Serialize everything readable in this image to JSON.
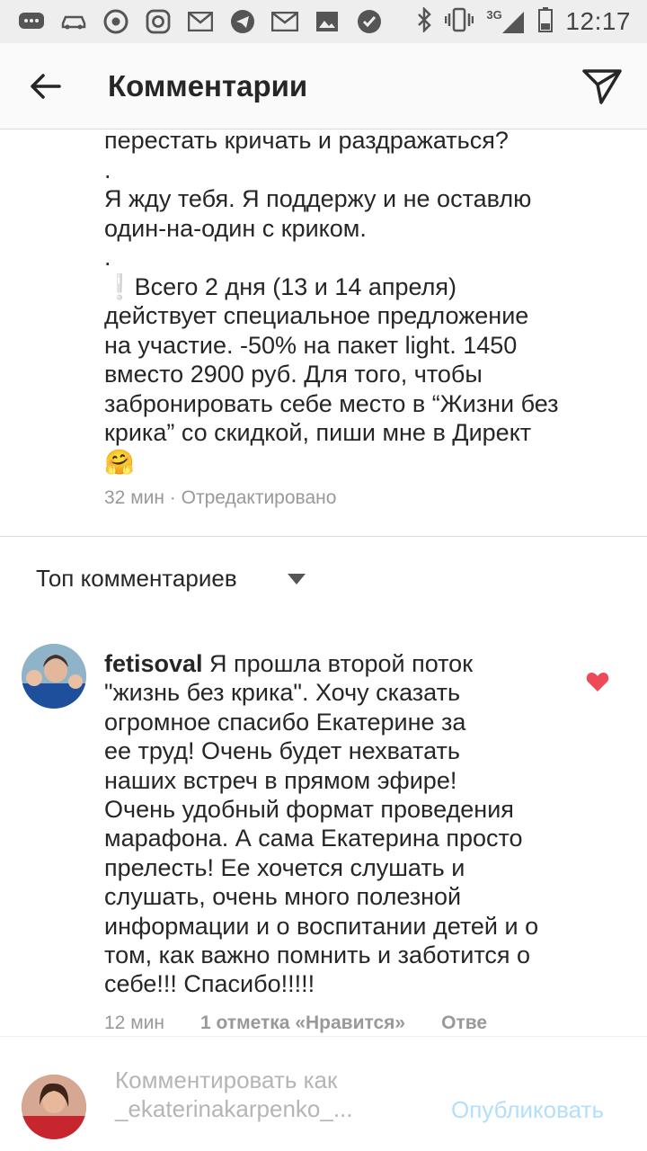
{
  "status_bar": {
    "time": "12:17",
    "network": "3G",
    "icons": [
      "message-icon",
      "car-icon",
      "chrome-icon",
      "instagram-icon",
      "gmail-icon",
      "telegram-icon",
      "mail-icon",
      "image-icon",
      "check-icon",
      "bluetooth-icon",
      "vibrate-icon",
      "signal-icon",
      "battery-icon"
    ]
  },
  "header": {
    "title": "Комментарии",
    "back_icon": "back-arrow-icon",
    "send_icon": "direct-send-icon"
  },
  "caption": {
    "text": "перестать кричать и раздражаться?\n.\nЯ жду тебя. Я поддержу и не оставлю\nодин-на-один с криком.\n.\n❕Всего 2 дня (13 и 14 апреля)\nдействует специальное предложение\nна участие. -50% на пакет light. 1450\nвместо 2900 руб. Для того, чтобы\nзабронировать себе место в “Жизни без\nкрика” со скидкой, пиши мне в Директ\n🤗",
    "meta": "32 мин · Отредактировано"
  },
  "sort": {
    "label": "Топ комментариев"
  },
  "comment": {
    "username": "fetisoval",
    "text": " Я прошла второй поток\n\"жизнь без крика\". Хочу сказать\nогромное спасибо Екатерине за\nее труд! Очень будет нехватать\nнаших встреч в прямом эфире!\nОчень удобный формат проведения\nмарафона. А сама Екатерина просто\nпрелесть! Ее хочется слушать и\nслушать, очень много полезной\nинформации и о воспитании детей и о\nтом, как важно помнить и заботится о\nсебе!!! Спасибо!!!!!",
    "time": "12 мин",
    "likes": "1 отметка «Нравится»",
    "reply": "Отве",
    "liked": true,
    "heart_color": "#ed4956"
  },
  "composer": {
    "placeholder": "Комментировать как\n_ekaterinakarpenko_...",
    "publish_label": "Опубликовать",
    "publish_color": "#b2dffc"
  }
}
